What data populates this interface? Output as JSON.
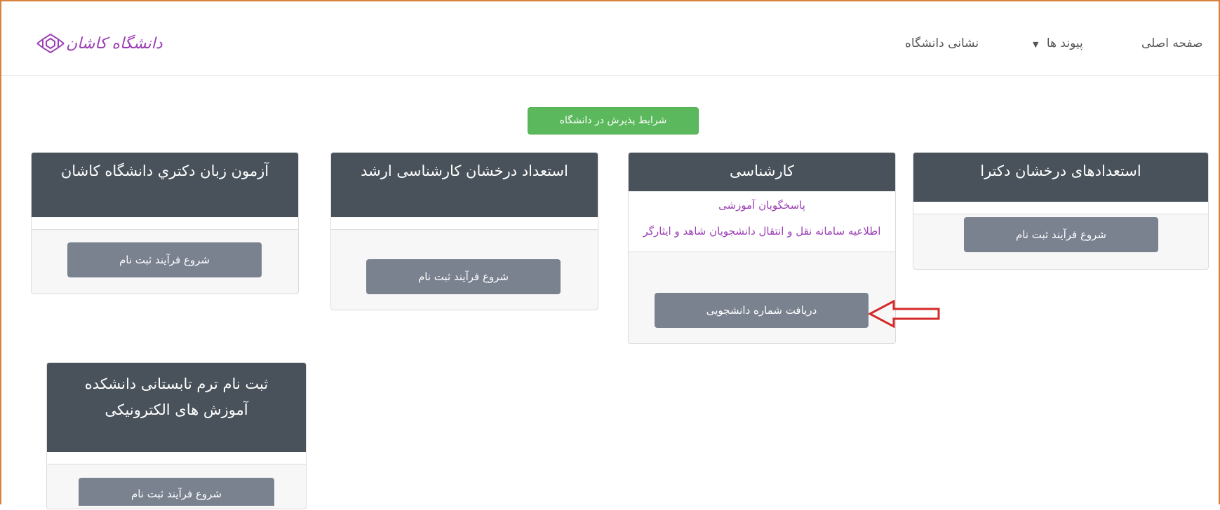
{
  "nav": {
    "home": "صفحه اصلی",
    "links": "پیوند ها",
    "address": "نشانی دانشگاه",
    "logo_text": "دانشگاه کاشان"
  },
  "admission_button": "شرایط پذیرش در دانشگاه",
  "cards": [
    {
      "title": "استعدادهای درخشان دکترا",
      "button": "شروع فرآیند ثبت نام"
    },
    {
      "title": "کارشناسی",
      "links": [
        "پاسخگویان آموزشی",
        "اطلاعیه سامانه نقل و انتقال دانشجویان شاهد و ایثارگر"
      ],
      "button": "دریافت شماره دانشجویی"
    },
    {
      "title": "استعداد درخشان کارشناسی ارشد",
      "button": "شروع فرآیند ثبت نام"
    },
    {
      "title": "آزمون زبان دکتري دانشگاه کاشان",
      "button": "شروع فرآیند ثبت نام"
    },
    {
      "title": "ثبت نام ترم تابستانی دانشکده آموزش های الکترونیکی",
      "button": "شروع فرآیند ثبت نام"
    }
  ],
  "colors": {
    "frame": "#d9823b",
    "card_header": "#49525b",
    "gray_button": "#7a8290",
    "green_button": "#5cb85c",
    "link": "#9c3fb5",
    "arrow": "#d42a2a"
  }
}
